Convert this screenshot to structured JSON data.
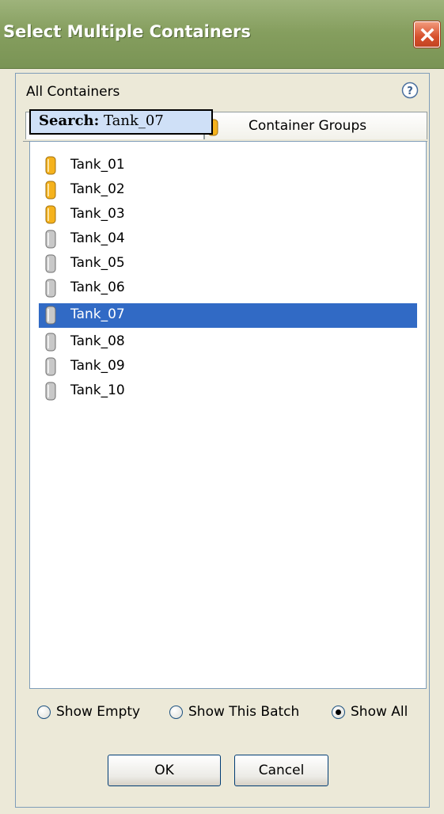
{
  "window": {
    "title": "Select Multiple Containers"
  },
  "header": {
    "label": "All Containers",
    "help_icon": "question-circle-icon"
  },
  "tabs": [
    {
      "label": "Search: Tank_07",
      "active": true
    },
    {
      "label": "Container Groups",
      "active": false
    }
  ],
  "search": {
    "prefix": "Search:",
    "query": "Tank_07"
  },
  "containers": [
    {
      "label": "Tank_01",
      "icon": "tank-icon",
      "color": "#f5b21d",
      "selected": false
    },
    {
      "label": "Tank_02",
      "icon": "tank-icon",
      "color": "#f5b21d",
      "selected": false
    },
    {
      "label": "Tank_03",
      "icon": "tank-icon",
      "color": "#f5b21d",
      "selected": false
    },
    {
      "label": "Tank_04",
      "icon": "tank-icon",
      "color": "#c8c8c8",
      "selected": false
    },
    {
      "label": "Tank_05",
      "icon": "tank-icon",
      "color": "#c8c8c8",
      "selected": false
    },
    {
      "label": "Tank_06",
      "icon": "tank-icon",
      "color": "#c8c8c8",
      "selected": false
    },
    {
      "label": "Tank_07",
      "icon": "tank-icon",
      "color": "#c8c8c8",
      "selected": true
    },
    {
      "label": "Tank_08",
      "icon": "tank-icon",
      "color": "#c8c8c8",
      "selected": false
    },
    {
      "label": "Tank_09",
      "icon": "tank-icon",
      "color": "#c8c8c8",
      "selected": false
    },
    {
      "label": "Tank_10",
      "icon": "tank-icon",
      "color": "#c8c8c8",
      "selected": false
    }
  ],
  "filter": {
    "options": [
      {
        "label": "Show Empty",
        "selected": false
      },
      {
        "label": "Show This Batch",
        "selected": false
      },
      {
        "label": "Show All",
        "selected": true
      }
    ]
  },
  "buttons": {
    "ok": "OK",
    "cancel": "Cancel"
  },
  "colors": {
    "titlebar": "#859e5e",
    "selection": "#316ac5",
    "tank_full": "#f5b21d",
    "tank_empty": "#c8c8c8",
    "tooltip": "#cfe0f7"
  }
}
